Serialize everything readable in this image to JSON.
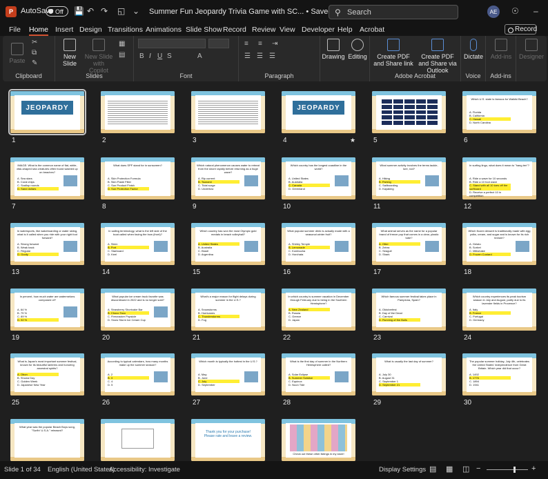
{
  "titlebar": {
    "app_badge": "P",
    "autosave_label": "AutoSave",
    "autosave_state": "Off",
    "doc_title": "Summer Fun Jeopardy Trivia Game with SC...",
    "save_status": "Saved to this PC",
    "search_placeholder": "Search",
    "user_initials": "AE"
  },
  "menu": {
    "tabs": [
      "File",
      "Home",
      "Insert",
      "Design",
      "Transitions",
      "Animations",
      "Slide Show",
      "Record",
      "Review",
      "View",
      "Developer",
      "Help",
      "Acrobat"
    ],
    "active": "Home",
    "record_label": "Record"
  },
  "ribbon": {
    "groups": {
      "clipboard": "Clipboard",
      "slides": "Slides",
      "font": "Font",
      "paragraph": "Paragraph",
      "adobe": "Adobe Acrobat",
      "voice": "Voice",
      "addins": "Add-ins"
    },
    "buttons": {
      "paste": "Paste",
      "new_slide": "New Slide",
      "new_slide_copilot": "New Slide with Copilot",
      "drawing": "Drawing",
      "editing": "Editing",
      "create_pdf_link": "Create PDF and Share link",
      "create_pdf_outlook": "Create PDF and Share via Outlook",
      "dictate": "Dictate",
      "addins": "Add-ins",
      "designer": "Designer"
    }
  },
  "slides": [
    {
      "n": "1",
      "kind": "cover",
      "title": "JEOPARDY",
      "selected": true
    },
    {
      "n": "2",
      "kind": "text"
    },
    {
      "n": "3",
      "kind": "text"
    },
    {
      "n": "4",
      "kind": "cover",
      "title": "JEOPARDY",
      "star": "★"
    },
    {
      "n": "5",
      "kind": "board"
    },
    {
      "n": "6",
      "kind": "q",
      "q": "Which U.S. state is famous for Waikiki Beach?",
      "a": [
        "A. Florida",
        "B. California",
        "C. Hawaii",
        "D. North Carolina"
      ],
      "hl": 2
    },
    {
      "n": "7",
      "kind": "q",
      "q": "IMAGE: What is the common name of flat, white, disk-shaped sea creatures often found washed up on beaches?",
      "a": [
        "A. Sea stars",
        "B. Coral chips",
        "C. Scallop rounds",
        "D. Sand dollars"
      ],
      "hl": 3,
      "pic": true
    },
    {
      "n": "8",
      "kind": "q",
      "q": "What does SPF stand for in sunscreen?",
      "a": [
        "A. Skin Protection Formula",
        "B. Skin Paste Filter",
        "C. Sun Product Finish",
        "D. Sun Protection Factor"
      ],
      "hl": 3
    },
    {
      "n": "9",
      "kind": "q",
      "q": "Which natural phenomenon causes water to retreat from the shore rapidly before returning as a huge wave?",
      "a": [
        "A. Rip current",
        "B. Tsunami",
        "C. Tidal surge",
        "D. Undertow"
      ],
      "hl": 1,
      "pic": true
    },
    {
      "n": "10",
      "kind": "q",
      "q": "Which country has the longest coastline in the world?",
      "a": [
        "A. United States",
        "B. Australia",
        "C. Canada",
        "D. Greenland"
      ],
      "hl": 2,
      "pic": true
    },
    {
      "n": "11",
      "kind": "q",
      "q": "What summer activity involves the terms tackle, lure, rod?",
      "a": [
        "A. Hiking",
        "B. Fishing",
        "C. Sailboarding",
        "D. Kayaking"
      ],
      "hl": 1,
      "pic": true
    },
    {
      "n": "12",
      "kind": "q",
      "q": "In surfing lingo, what does it mean to \"hang ten\"?",
      "a": [
        "A. Ride a wave for 10 seconds",
        "B. Ride a 10 foot wave",
        "C. Stand with all 10 toes off the surfboard",
        "D. Receive a perfect 10 in competition"
      ],
      "hl": 2
    },
    {
      "n": "13",
      "kind": "q",
      "q": "In watersports, like wakeboarding or water skiing, what is it called when you ride with your right foot forward?",
      "a": [
        "A. Strong forward",
        "B. Weak back",
        "C. Regular",
        "D. Goofy"
      ],
      "hl": 3,
      "pic": true
    },
    {
      "n": "14",
      "kind": "q",
      "q": "In sailing terminology, what is the left side of the boat called when facing the bow (front)?",
      "a": [
        "A. Stern",
        "B. Port",
        "C. Starboard",
        "D. Keel"
      ],
      "hl": 1,
      "pic": true
    },
    {
      "n": "15",
      "kind": "q",
      "q": "Which country has won the most Olympic gold medals in beach volleyball?",
      "a": [
        "A. United States",
        "B. Australia",
        "C. Brazil",
        "D. Argentina"
      ],
      "hl": 0,
      "pic": true
    },
    {
      "n": "16",
      "kind": "q",
      "q": "What popular summer drink is actually made with a seasonal winter fruit?",
      "a": [
        "A. Shirley Temple",
        "B. Lemonade",
        "C. Kombucha",
        "D. Horchata"
      ],
      "hl": 1,
      "pic": true
    },
    {
      "n": "17",
      "kind": "q",
      "q": "What animal serves as the name for a popular brand of freeze pop that comes in a clear, plastic tube?",
      "a": [
        "A. Otter",
        "B. Zebra",
        "C. Seagull",
        "D. Shark"
      ],
      "hl": 0,
      "pic": true
    },
    {
      "n": "18",
      "kind": "q",
      "q": "Which frozen dessert is traditionally made with egg yolks, cream, and sugar and is known for its rich texture?",
      "a": [
        "A. Gelato",
        "B. Sorbet",
        "C. Milkshake",
        "D. Frozen Custard"
      ],
      "hl": 3,
      "pic": true
    },
    {
      "n": "19",
      "kind": "q",
      "q": "In percent, how much water are watermelons composed of?",
      "a": [
        "A. 64 %",
        "B. 79 %",
        "C. 89 %",
        "D. 92 %"
      ],
      "hl": 3,
      "pic": true
    },
    {
      "n": "20",
      "kind": "q",
      "q": "What popular ice cream truck favorite was discontinued in 2022 and is no longer sold?",
      "a": [
        "A. Strawberry Shortcake Bar",
        "B. Choco Taco",
        "C. Firecracker Popsicle",
        "D. Snow Storm Ice Cream Cup"
      ],
      "hl": 1,
      "pic": true
    },
    {
      "n": "21",
      "kind": "q",
      "q": "What's a major reason for flight delays during summer in the U.S.?",
      "a": [
        "A. Snowstorms",
        "B. Hurricanes",
        "C. Thunderstorms",
        "D. Fog"
      ],
      "hl": 2
    },
    {
      "n": "22",
      "kind": "q",
      "q": "In which country is summer vacation in December through February due to being in the Southern Hemisphere?",
      "a": [
        "A. New Zealand",
        "B. Russia",
        "C. Greece",
        "D. Japan"
      ],
      "hl": 0
    },
    {
      "n": "23",
      "kind": "q",
      "q": "Which famous summer festival takes place in Pamplona, Spain?",
      "a": [
        "A. Oktoberfest",
        "B. Day of the Dead",
        "C. Carnival",
        "D. Running of the Bulls"
      ],
      "hl": 3
    },
    {
      "n": "24",
      "kind": "q",
      "q": "Which country experiences its peak tourism season in July and August, partly due to its lavender fields in Provence?",
      "a": [
        "A. Italy",
        "B. France",
        "C. Portugal",
        "D. Germany"
      ],
      "hl": 1
    },
    {
      "n": "25",
      "kind": "q",
      "q": "What is Japan's most important summer festival, known for its beautiful lanterns and honoring ancestral spirits?",
      "a": [
        "A. Obon",
        "B. Showa Day",
        "C. Golden Week",
        "D. Japanese New Year"
      ],
      "hl": 0
    },
    {
      "n": "26",
      "kind": "q",
      "q": "According to typical calendars, how many months make up the summer season?",
      "a": [
        "A. 2",
        "B. 3",
        "C. 4",
        "D. 5"
      ],
      "hl": 1,
      "pic": true
    },
    {
      "n": "27",
      "kind": "q",
      "q": "Which month is typically the hottest in the U.S.?",
      "a": [
        "A. May",
        "B. June",
        "C. July",
        "D. September"
      ],
      "hl": 2,
      "pic": true
    },
    {
      "n": "28",
      "kind": "q",
      "q": "What is the first day of summer in the Northern Hemisphere called?",
      "a": [
        "A. Solar Eclipse",
        "B. Summer Solstice",
        "C. Equinox",
        "D. Noon Tide"
      ],
      "hl": 1,
      "pic": true
    },
    {
      "n": "29",
      "kind": "q",
      "q": "What is usually the last day of summer?",
      "a": [
        "A. July 30",
        "B. August 31",
        "C. September 1",
        "D. September 21"
      ],
      "hl": 3
    },
    {
      "n": "30",
      "kind": "q",
      "q": "The popular summer holiday, July 4th, celebrates the United States' independence from Great Britain. Which year did that occur?",
      "a": [
        "A. 1492",
        "B. 1776",
        "C. 1894",
        "D. 1941"
      ],
      "hl": 1
    },
    {
      "n": "31",
      "kind": "q",
      "q": "What year was the popular Beach Boys song, \"Surfin' U.S.A.\" released?",
      "a": [],
      "hl": -1
    },
    {
      "n": "32",
      "kind": "cover2"
    },
    {
      "n": "33",
      "kind": "thanks",
      "q": "Thank you for your purchase! Please rate and leave a review."
    },
    {
      "n": "34",
      "kind": "collage",
      "q": "Check out these other listings in my store!"
    }
  ],
  "status": {
    "slide_of": "Slide 1 of 34",
    "language": "English (United States)",
    "accessibility": "Accessibility: Investigate",
    "display_settings": "Display Settings"
  },
  "colors": {
    "accent": "#d35230",
    "ppt_brand": "#c43e1c",
    "highlight": "#ffee33"
  }
}
